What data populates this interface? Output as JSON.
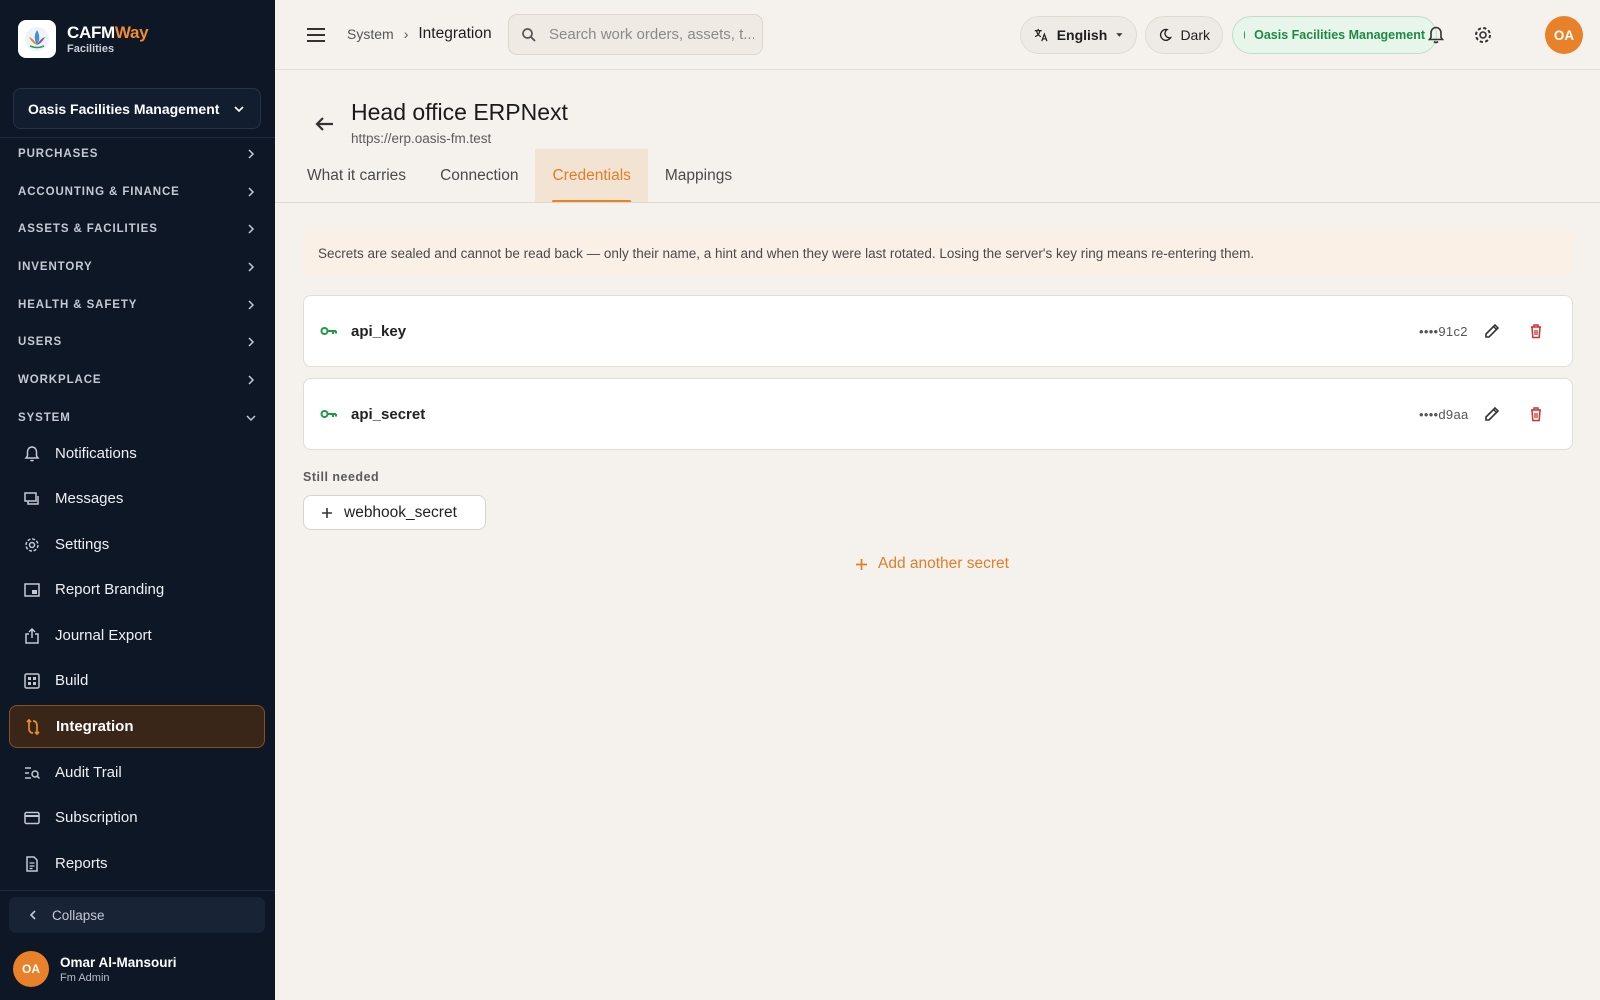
{
  "brand": {
    "name_main": "CAFM",
    "name_accent": "Way",
    "subtitle": "Facilities"
  },
  "org_selector": {
    "label": "Oasis Facilities Management"
  },
  "nav_groups": [
    {
      "label": "PURCHASES",
      "expanded": false
    },
    {
      "label": "ACCOUNTING & FINANCE",
      "expanded": false
    },
    {
      "label": "ASSETS & FACILITIES",
      "expanded": false
    },
    {
      "label": "INVENTORY",
      "expanded": false
    },
    {
      "label": "HEALTH & SAFETY",
      "expanded": false
    },
    {
      "label": "USERS",
      "expanded": false
    },
    {
      "label": "WORKPLACE",
      "expanded": false
    },
    {
      "label": "SYSTEM",
      "expanded": true
    }
  ],
  "system_items": [
    {
      "label": "Notifications",
      "icon": "bell-icon"
    },
    {
      "label": "Messages",
      "icon": "chat-icon"
    },
    {
      "label": "Settings",
      "icon": "gear-icon"
    },
    {
      "label": "Report Branding",
      "icon": "branding-icon"
    },
    {
      "label": "Journal Export",
      "icon": "export-icon"
    },
    {
      "label": "Build",
      "icon": "build-icon"
    },
    {
      "label": "Integration",
      "icon": "integration-icon",
      "active": true
    },
    {
      "label": "Audit Trail",
      "icon": "audit-icon"
    },
    {
      "label": "Subscription",
      "icon": "card-icon"
    },
    {
      "label": "Reports",
      "icon": "reports-icon"
    }
  ],
  "collapse_label": "Collapse",
  "user": {
    "initials": "OA",
    "name": "Omar Al-Mansouri",
    "role": "Fm Admin"
  },
  "breadcrumb": {
    "parent": "System",
    "current": "Integration"
  },
  "search": {
    "placeholder": "Search work orders, assets, t..."
  },
  "language": {
    "label": "English"
  },
  "theme": {
    "label": "Dark"
  },
  "org_status": {
    "label": "Oasis Facilities Management",
    "color": "#1f9a47"
  },
  "header": {
    "title": "Head office ERPNext",
    "url": "https://erp.oasis-fm.test"
  },
  "tabs": [
    {
      "label": "What it carries",
      "active": false
    },
    {
      "label": "Connection",
      "active": false
    },
    {
      "label": "Credentials",
      "active": true
    },
    {
      "label": "Mappings",
      "active": false
    }
  ],
  "info_text": "Secrets are sealed and cannot be read back — only their name, a hint and when they were last rotated. Losing the server's key ring means re-entering them.",
  "secrets": [
    {
      "name": "api_key",
      "hint": "••••91c2"
    },
    {
      "name": "api_secret",
      "hint": "••••d9aa"
    }
  ],
  "still_needed": {
    "label": "Still needed",
    "items": [
      "webhook_secret"
    ]
  },
  "add_secret_label": "Add another secret",
  "colors": {
    "accent": "#e9812b",
    "sidebar_bg": "#0e1726",
    "success": "#1f9a47",
    "danger": "#d32f2f"
  }
}
